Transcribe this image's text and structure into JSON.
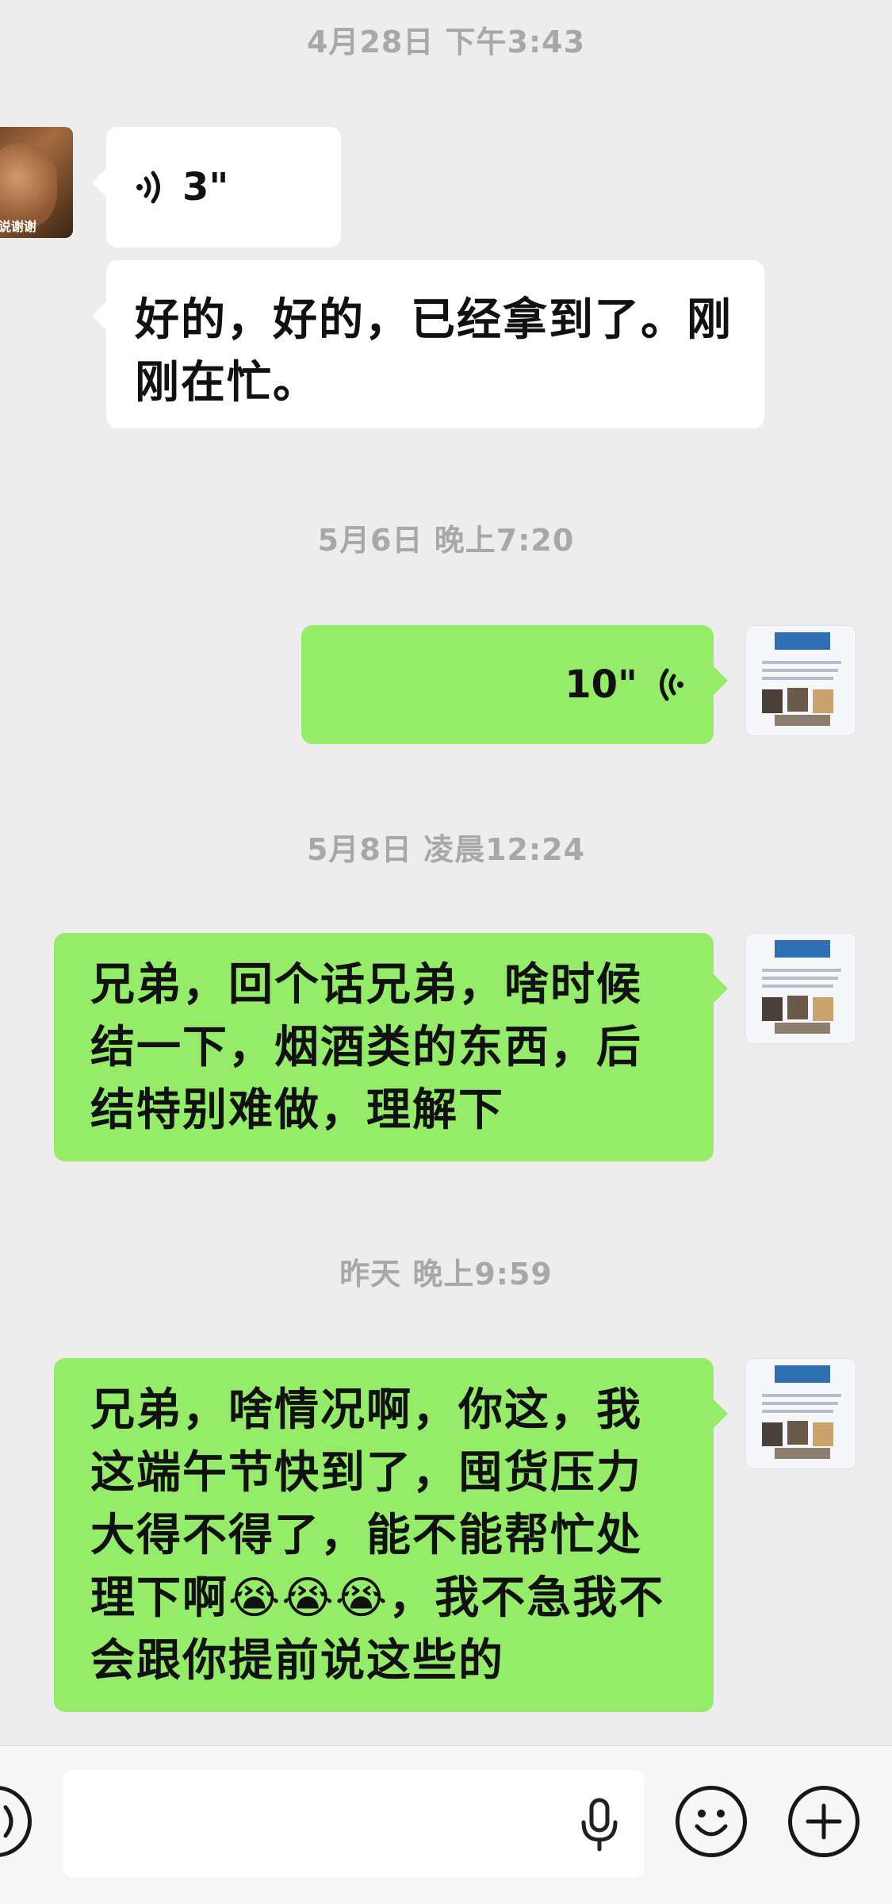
{
  "messages": [
    {
      "type": "timestamp",
      "text": "4月28日 下午3:43"
    },
    {
      "type": "voice",
      "side": "left",
      "duration": "3\""
    },
    {
      "type": "text",
      "side": "left",
      "lines": [
        "好的，好的，已经拿到了。刚",
        "刚在忙。"
      ]
    },
    {
      "type": "timestamp",
      "text": "5月6日 晚上7:20"
    },
    {
      "type": "voice",
      "side": "right",
      "duration": "10\""
    },
    {
      "type": "timestamp",
      "text": "5月8日 凌晨12:24"
    },
    {
      "type": "text",
      "side": "right",
      "lines": [
        "兄弟，回个话兄弟，啥时候",
        "结一下，烟酒类的东西，后",
        "结特别难做，理解下"
      ]
    },
    {
      "type": "timestamp",
      "text": "昨天 晚上9:59"
    },
    {
      "type": "text",
      "side": "right",
      "lines": [
        "兄弟，啥情况啊，你这，我",
        "这端午节快到了，囤货压力",
        "大得不得了，能不能帮忙处",
        "理下啊😭😭😭，我不急我不",
        "会跟你提前说这些的"
      ]
    }
  ],
  "avatars": {
    "left_caption": "说谢谢"
  },
  "colors": {
    "background": "#ededed",
    "outgoing_bubble": "#95ec69",
    "incoming_bubble": "#ffffff",
    "timestamp": "#a8a8a8"
  },
  "chatbar": {
    "left_icon": "voice-mode-icon",
    "input_value": "",
    "input_icon": "microphone-icon",
    "emoji_icon": "emoji-icon",
    "plus_icon": "plus-icon"
  }
}
